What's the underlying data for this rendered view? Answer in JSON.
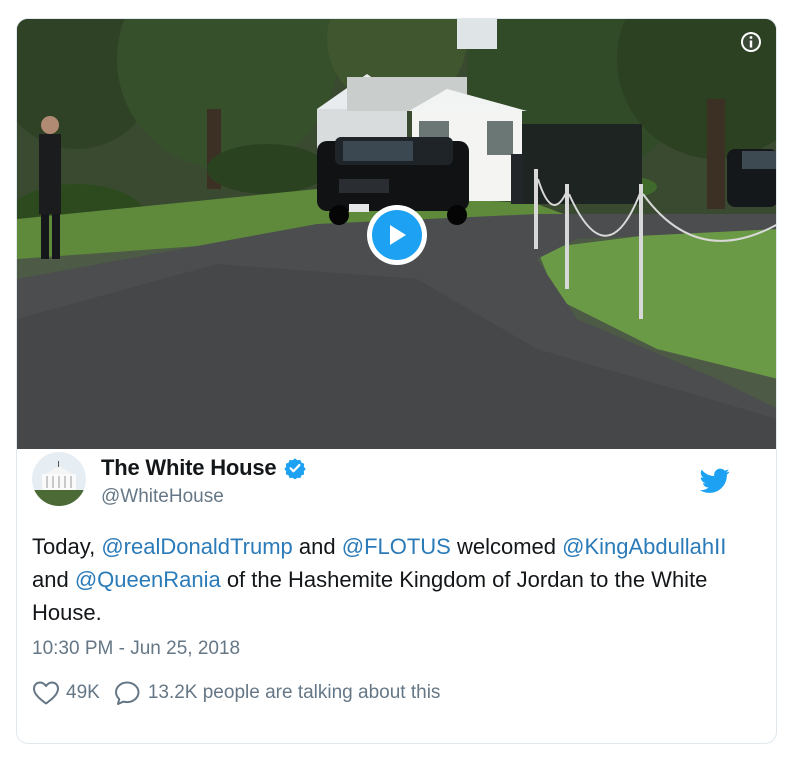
{
  "media": {
    "type": "video",
    "icons": {
      "play": "play-icon",
      "info": "info-icon"
    },
    "colors": {
      "play": "#1da1f2"
    }
  },
  "author": {
    "display_name": "The White House",
    "handle": "@WhiteHouse",
    "verified": true,
    "avatar_icon": "white-house-avatar"
  },
  "tweet": {
    "segments": [
      {
        "text": "Today, ",
        "mention": false
      },
      {
        "text": "@realDonaldTrump",
        "mention": true
      },
      {
        "text": " and ",
        "mention": false
      },
      {
        "text": "@FLOTUS",
        "mention": true
      },
      {
        "text": " welcomed ",
        "mention": false
      },
      {
        "text": "@KingAbdullahII",
        "mention": true
      },
      {
        "text": " and ",
        "mention": false
      },
      {
        "text": "@QueenRania",
        "mention": true
      },
      {
        "text": " of the Hashemite Kingdom of Jordan to the White House.",
        "mention": false
      }
    ],
    "timestamp": "10:30 PM - Jun 25, 2018"
  },
  "actions": {
    "likes": "49K",
    "conversation": "13.2K people are talking about this",
    "icons": {
      "like": "heart-icon",
      "reply": "comment-icon",
      "brand": "twitter-bird-icon"
    }
  },
  "colors": {
    "link": "#2b7bb9",
    "brand": "#1da1f2",
    "muted": "#657786",
    "text": "#14171a"
  }
}
